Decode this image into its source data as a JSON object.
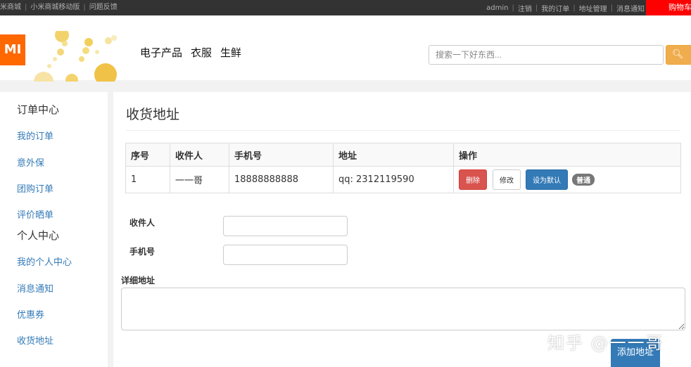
{
  "topbar": {
    "left_links": [
      "米商城",
      "小米商城移动版",
      "问题反馈"
    ],
    "right_links": [
      "admin",
      "注销",
      "我的订单",
      "地址管理",
      "消息通知"
    ],
    "cart_label": "购物车"
  },
  "header": {
    "logo_text": "MI",
    "nav": [
      "电子产品",
      "衣服",
      "生鲜"
    ],
    "search_placeholder": "搜索一下好东西...",
    "search_button": "搜"
  },
  "sidebar": {
    "order_center": {
      "title": "订单中心",
      "items": [
        "我的订单",
        "意外保",
        "团购订单",
        "评价晒单"
      ]
    },
    "personal_center": {
      "title": "个人中心",
      "items": [
        "我的个人中心",
        "消息通知",
        "优惠券",
        "收货地址"
      ]
    }
  },
  "main": {
    "title": "收货地址",
    "table": {
      "headers": [
        "序号",
        "收件人",
        "手机号",
        "地址",
        "操作"
      ],
      "rows": [
        {
          "index": "1",
          "recipient": "一一哥",
          "phone": "18888888888",
          "address": "qq: 2312119590",
          "delete_label": "删除",
          "edit_label": "修改",
          "default_label": "设为默认",
          "badge": "普通"
        }
      ]
    },
    "form": {
      "recipient_label": "收件人",
      "phone_label": "手机号",
      "address_label": "详细地址",
      "recipient_value": "",
      "phone_value": "",
      "address_value": "",
      "submit_label": "添加地址"
    }
  },
  "watermark": "知乎 @一一哥",
  "colors": {
    "topbar_bg": "#333333",
    "cart_bg": "#ff0000",
    "logo_bg": "#ff6700",
    "link": "#337ab7",
    "danger": "#d9534f",
    "primary": "#337ab7",
    "warning": "#f0ad4e"
  }
}
